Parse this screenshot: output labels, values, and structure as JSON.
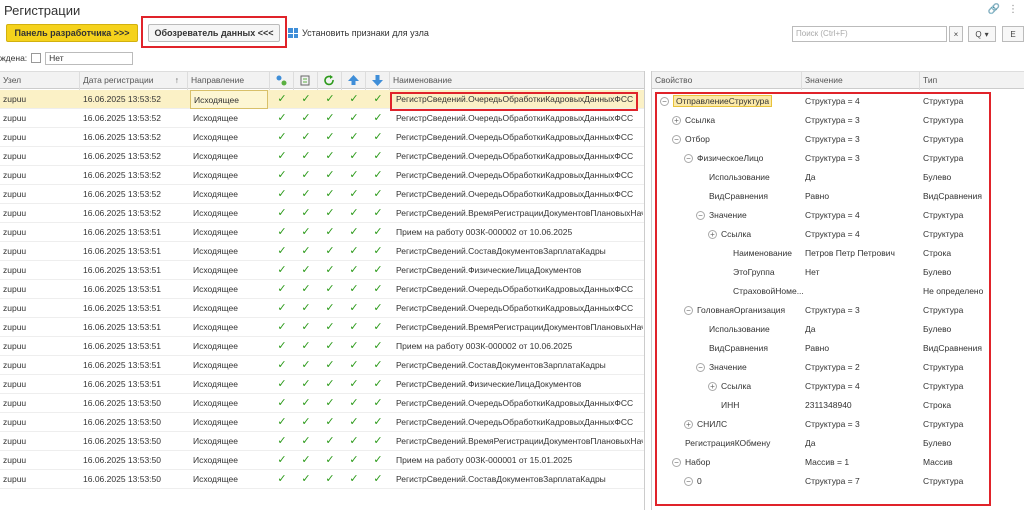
{
  "window": {
    "title": "Регистрации"
  },
  "toolbar": {
    "dev_panel": "Панель разработчика >>>",
    "data_browser": "Обозреватель данных <<<",
    "set_flags": "Установить признаки для узла",
    "search_placeholder": "Поиск (Ctrl+F)",
    "clear": "×",
    "search": "Q",
    "more": "Е"
  },
  "filter": {
    "label": "ждена:",
    "value": "Нет"
  },
  "left_table": {
    "columns": [
      "Узел",
      "Дата регистрации",
      "Направление",
      "Наименование"
    ],
    "sort_mark": "↑",
    "rows": [
      {
        "node": "zupuu",
        "date": "16.06.2025 13:53:52",
        "dir": "Исходящее",
        "name": "РегистрСведений.ОчередьОбработкиКадровыхДанныхФСС"
      },
      {
        "node": "zupuu",
        "date": "16.06.2025 13:53:52",
        "dir": "Исходящее",
        "name": "РегистрСведений.ОчередьОбработкиКадровыхДанныхФСС"
      },
      {
        "node": "zupuu",
        "date": "16.06.2025 13:53:52",
        "dir": "Исходящее",
        "name": "РегистрСведений.ОчередьОбработкиКадровыхДанныхФСС"
      },
      {
        "node": "zupuu",
        "date": "16.06.2025 13:53:52",
        "dir": "Исходящее",
        "name": "РегистрСведений.ОчередьОбработкиКадровыхДанныхФСС"
      },
      {
        "node": "zupuu",
        "date": "16.06.2025 13:53:52",
        "dir": "Исходящее",
        "name": "РегистрСведений.ОчередьОбработкиКадровыхДанныхФСС"
      },
      {
        "node": "zupuu",
        "date": "16.06.2025 13:53:52",
        "dir": "Исходящее",
        "name": "РегистрСведений.ОчередьОбработкиКадровыхДанныхФСС"
      },
      {
        "node": "zupuu",
        "date": "16.06.2025 13:53:52",
        "dir": "Исходящее",
        "name": "РегистрСведений.ВремяРегистрацииДокументовПлановыхНачи"
      },
      {
        "node": "zupuu",
        "date": "16.06.2025 13:53:51",
        "dir": "Исходящее",
        "name": "Прием на работу 00ЗК-000002 от 10.06.2025"
      },
      {
        "node": "zupuu",
        "date": "16.06.2025 13:53:51",
        "dir": "Исходящее",
        "name": "РегистрСведений.СоставДокументовЗарплатаКадры"
      },
      {
        "node": "zupuu",
        "date": "16.06.2025 13:53:51",
        "dir": "Исходящее",
        "name": "РегистрСведений.ФизическиеЛицаДокументов"
      },
      {
        "node": "zupuu",
        "date": "16.06.2025 13:53:51",
        "dir": "Исходящее",
        "name": "РегистрСведений.ОчередьОбработкиКадровыхДанныхФСС"
      },
      {
        "node": "zupuu",
        "date": "16.06.2025 13:53:51",
        "dir": "Исходящее",
        "name": "РегистрСведений.ОчередьОбработкиКадровыхДанныхФСС"
      },
      {
        "node": "zupuu",
        "date": "16.06.2025 13:53:51",
        "dir": "Исходящее",
        "name": "РегистрСведений.ВремяРегистрацииДокументовПлановыхНачи"
      },
      {
        "node": "zupuu",
        "date": "16.06.2025 13:53:51",
        "dir": "Исходящее",
        "name": "Прием на работу 00ЗК-000002 от 10.06.2025"
      },
      {
        "node": "zupuu",
        "date": "16.06.2025 13:53:51",
        "dir": "Исходящее",
        "name": "РегистрСведений.СоставДокументовЗарплатаКадры"
      },
      {
        "node": "zupuu",
        "date": "16.06.2025 13:53:51",
        "dir": "Исходящее",
        "name": "РегистрСведений.ФизическиеЛицаДокументов"
      },
      {
        "node": "zupuu",
        "date": "16.06.2025 13:53:50",
        "dir": "Исходящее",
        "name": "РегистрСведений.ОчередьОбработкиКадровыхДанныхФСС"
      },
      {
        "node": "zupuu",
        "date": "16.06.2025 13:53:50",
        "dir": "Исходящее",
        "name": "РегистрСведений.ОчередьОбработкиКадровыхДанныхФСС"
      },
      {
        "node": "zupuu",
        "date": "16.06.2025 13:53:50",
        "dir": "Исходящее",
        "name": "РегистрСведений.ВремяРегистрацииДокументовПлановыхНачи"
      },
      {
        "node": "zupuu",
        "date": "16.06.2025 13:53:50",
        "dir": "Исходящее",
        "name": "Прием на работу 00ЗК-000001 от 15.01.2025"
      },
      {
        "node": "zupuu",
        "date": "16.06.2025 13:53:50",
        "dir": "Исходящее",
        "name": "РегистрСведений.СоставДокументовЗарплатаКадры"
      }
    ],
    "tick_glyph": "✓"
  },
  "right_tree": {
    "columns": [
      "Свойство",
      "Значение",
      "Тип"
    ],
    "rows": [
      {
        "level": 0,
        "exp": "−",
        "prop": "ОтправлениеСтруктура",
        "value": "Структура = 4",
        "type": "Структура"
      },
      {
        "level": 1,
        "exp": "+",
        "prop": "Ссылка",
        "value": "Структура = 3",
        "type": "Структура"
      },
      {
        "level": 1,
        "exp": "−",
        "prop": "Отбор",
        "value": "Структура = 3",
        "type": "Структура"
      },
      {
        "level": 2,
        "exp": "−",
        "prop": "ФизическоеЛицо",
        "value": "Структура = 3",
        "type": "Структура"
      },
      {
        "level": 3,
        "exp": "",
        "prop": "Использование",
        "value": "Да",
        "type": "Булево"
      },
      {
        "level": 3,
        "exp": "",
        "prop": "ВидСравнения",
        "value": "Равно",
        "type": "ВидСравнения"
      },
      {
        "level": 3,
        "exp": "−",
        "prop": "Значение",
        "value": "Структура = 4",
        "type": "Структура"
      },
      {
        "level": 4,
        "exp": "+",
        "prop": "Ссылка",
        "value": "Структура = 4",
        "type": "Структура"
      },
      {
        "level": 5,
        "exp": "",
        "prop": "Наименование",
        "value": "Петров Петр Петрович",
        "type": "Строка"
      },
      {
        "level": 5,
        "exp": "",
        "prop": "ЭтоГруппа",
        "value": "Нет",
        "type": "Булево"
      },
      {
        "level": 5,
        "exp": "",
        "prop": "СтраховойНоме...",
        "value": "",
        "type": "Не определено"
      },
      {
        "level": 2,
        "exp": "−",
        "prop": "ГоловнаяОрганизация",
        "value": "Структура = 3",
        "type": "Структура"
      },
      {
        "level": 3,
        "exp": "",
        "prop": "Использование",
        "value": "Да",
        "type": "Булево"
      },
      {
        "level": 3,
        "exp": "",
        "prop": "ВидСравнения",
        "value": "Равно",
        "type": "ВидСравнения"
      },
      {
        "level": 3,
        "exp": "−",
        "prop": "Значение",
        "value": "Структура = 2",
        "type": "Структура"
      },
      {
        "level": 4,
        "exp": "+",
        "prop": "Ссылка",
        "value": "Структура = 4",
        "type": "Структура"
      },
      {
        "level": 4,
        "exp": "",
        "prop": "ИНН",
        "value": "2311348940",
        "type": "Строка"
      },
      {
        "level": 2,
        "exp": "+",
        "prop": "СНИЛС",
        "value": "Структура = 3",
        "type": "Структура"
      },
      {
        "level": 1,
        "exp": "",
        "prop": "РегистрацияКОбмену",
        "value": "Да",
        "type": "Булево"
      },
      {
        "level": 1,
        "exp": "−",
        "prop": "Набор",
        "value": "Массив = 1",
        "type": "Массив"
      },
      {
        "level": 2,
        "exp": "−",
        "prop": "0",
        "value": "Структура = 7",
        "type": "Структура"
      }
    ]
  },
  "colors": {
    "accent_yellow": "#f5d21c",
    "highlight_red": "#e0232a",
    "tick_green": "#2c9a1a",
    "selected_row": "#fbf1c6"
  }
}
